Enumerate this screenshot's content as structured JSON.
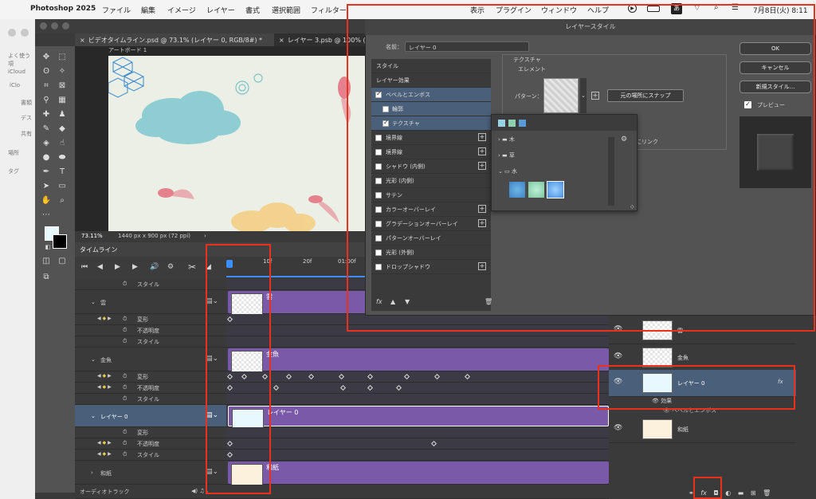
{
  "menubar": {
    "apple": "",
    "app": "Photoshop 2025",
    "items": [
      "ファイル",
      "編集",
      "イメージ",
      "レイヤー",
      "書式",
      "選択範囲",
      "フィルター"
    ],
    "right_items": [
      "表示",
      "プラグイン",
      "ウィンドウ",
      "ヘルプ"
    ],
    "ime": "あ",
    "datetime": "7月8日(火) 8:11"
  },
  "finder": {
    "favorites": "よく使う項",
    "icloud": "iCloud",
    "icloud_items": [
      "iClo",
      "書類",
      "デス",
      "共有"
    ],
    "places": "場所",
    "tags": "タグ"
  },
  "tabs": [
    {
      "label": "ビデオタイムライン.psd @ 73.1% (レイヤー 0, RGB/8#) *"
    },
    {
      "label": "レイヤー 3.psb @ 100% (L"
    }
  ],
  "artboard_label": "アートボード 1",
  "status": {
    "zoom": "73.11%",
    "size": "1440 px x 900 px (72 ppi)",
    "arrow": "›"
  },
  "timeline": {
    "tab_label": "タイムライン",
    "ruler": [
      "10f",
      "20f",
      "01:00f"
    ],
    "rows": [
      {
        "label": "スタイル",
        "type": "prop"
      },
      {
        "label": "雲",
        "type": "layer"
      },
      {
        "label": "変形",
        "type": "prop"
      },
      {
        "label": "不透明度",
        "type": "prop"
      },
      {
        "label": "スタイル",
        "type": "prop"
      },
      {
        "label": "金魚",
        "type": "layer"
      },
      {
        "label": "変形",
        "type": "prop"
      },
      {
        "label": "不透明度",
        "type": "prop"
      },
      {
        "label": "スタイル",
        "type": "prop"
      },
      {
        "label": "レイヤー 0",
        "type": "layer"
      },
      {
        "label": "変形",
        "type": "prop"
      },
      {
        "label": "不透明度",
        "type": "prop"
      },
      {
        "label": "スタイル",
        "type": "prop"
      },
      {
        "label": "和紙",
        "type": "layer"
      }
    ],
    "clips": [
      "雲",
      "金魚",
      "レイヤー 0",
      "和紙"
    ],
    "audio": "オーディオトラック"
  },
  "layers": {
    "items": [
      {
        "name": "雲"
      },
      {
        "name": "金魚"
      },
      {
        "name": "レイヤー 0",
        "fx": "fx"
      },
      {
        "name": "和紙"
      }
    ],
    "effects_label": "効果",
    "effect_item": "ベベルとエンボス",
    "bottom_fx": "fx"
  },
  "dialog": {
    "title": "レイヤースタイル",
    "name_label": "名前：",
    "name_value": "レイヤー 0",
    "list": [
      {
        "label": "スタイル",
        "check": null,
        "plus": false
      },
      {
        "label": "レイヤー効果",
        "check": null,
        "plus": false
      },
      {
        "label": "ベベルとエンボス",
        "check": true,
        "plus": false
      },
      {
        "label": "輪郭",
        "check": false,
        "plus": false
      },
      {
        "label": "テクスチャ",
        "check": true,
        "plus": false
      },
      {
        "label": "境界線",
        "check": false,
        "plus": true
      },
      {
        "label": "境界線",
        "check": false,
        "plus": true
      },
      {
        "label": "シャドウ (内側)",
        "check": false,
        "plus": true
      },
      {
        "label": "光彩 (内側)",
        "check": false,
        "plus": false
      },
      {
        "label": "サテン",
        "check": false,
        "plus": false
      },
      {
        "label": "カラーオーバーレイ",
        "check": false,
        "plus": true
      },
      {
        "label": "グラデーションオーバーレイ",
        "check": false,
        "plus": true
      },
      {
        "label": "パターンオーバーレイ",
        "check": false,
        "plus": false
      },
      {
        "label": "光彩 (外側)",
        "check": false,
        "plus": false
      },
      {
        "label": "ドロップシャドウ",
        "check": false,
        "plus": true
      }
    ],
    "fx_label": "fx",
    "texture_group": "テクスチャ",
    "element_label": "エレメント",
    "pattern_label": "パターン：",
    "snap_button": "元の場所にスナップ",
    "link_label": "にリンク",
    "ok": "OK",
    "cancel": "キャンセル",
    "new_style": "新規スタイル...",
    "preview_label": "プレビュー"
  },
  "picker": {
    "folders": [
      {
        "name": "木",
        "open": false
      },
      {
        "name": "草",
        "open": false
      },
      {
        "name": "水",
        "open": true
      }
    ]
  },
  "colors": {
    "clip": "#7a5aa8",
    "highlight": "#e8321e",
    "selection": "#4a607a"
  }
}
